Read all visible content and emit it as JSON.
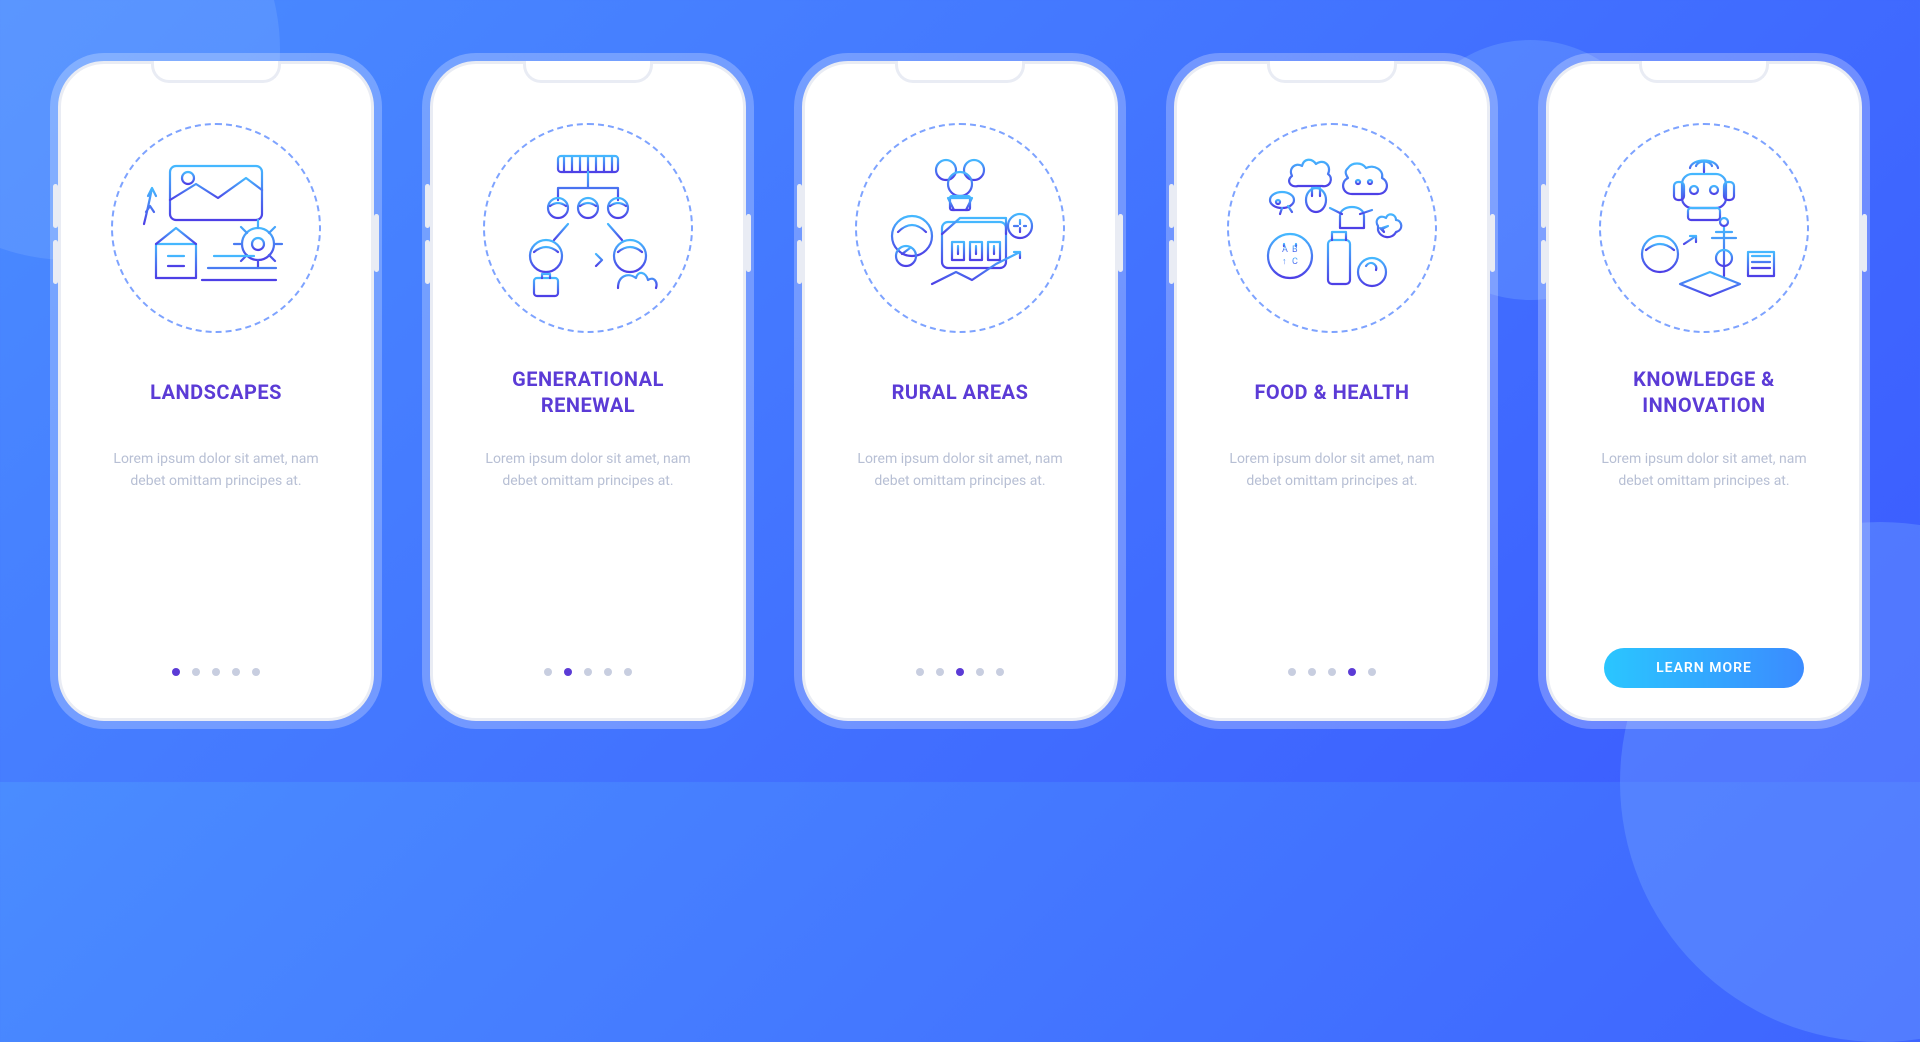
{
  "screens": [
    {
      "icon": "landscapes-icon",
      "title": "LANDSCAPES",
      "body": "Lorem ipsum dolor sit amet, nam debet omittam principes at.",
      "dot_count": 5,
      "active_dot": 0,
      "has_cta": false
    },
    {
      "icon": "generational-renewal-icon",
      "title": "GENERATIONAL\nRENEWAL",
      "body": "Lorem ipsum dolor sit amet, nam debet omittam principes at.",
      "dot_count": 5,
      "active_dot": 1,
      "has_cta": false
    },
    {
      "icon": "rural-areas-icon",
      "title": "RURAL AREAS",
      "body": "Lorem ipsum dolor sit amet, nam debet omittam principes at.",
      "dot_count": 5,
      "active_dot": 2,
      "has_cta": false
    },
    {
      "icon": "food-health-icon",
      "title": "FOOD & HEALTH",
      "body": "Lorem ipsum dolor sit amet, nam debet omittam principes at.",
      "dot_count": 5,
      "active_dot": 3,
      "has_cta": false
    },
    {
      "icon": "knowledge-innovation-icon",
      "title": "KNOWLEDGE &\nINNOVATION",
      "body": "Lorem ipsum dolor sit amet, nam debet omittam principes at.",
      "dot_count": 5,
      "active_dot": 4,
      "has_cta": true
    }
  ],
  "cta_label": "LEARN MORE",
  "colors": {
    "accent": "#5b3bd6",
    "cta_gradient_start": "#2ac6ff",
    "cta_gradient_end": "#3b8bff",
    "bg_gradient_start": "#4a8cff",
    "bg_gradient_end": "#3b5bff"
  }
}
